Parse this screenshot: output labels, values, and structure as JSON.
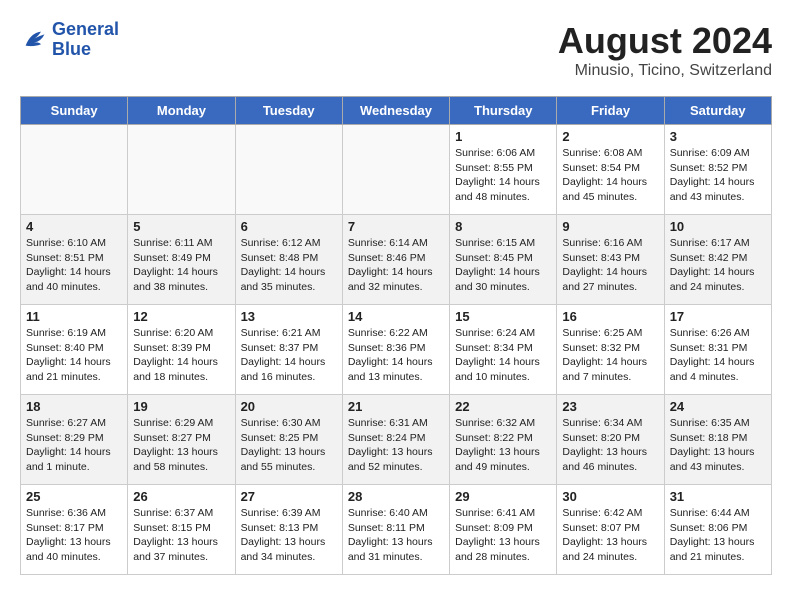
{
  "header": {
    "logo_line1": "General",
    "logo_line2": "Blue",
    "month_year": "August 2024",
    "location": "Minusio, Ticino, Switzerland"
  },
  "days_of_week": [
    "Sunday",
    "Monday",
    "Tuesday",
    "Wednesday",
    "Thursday",
    "Friday",
    "Saturday"
  ],
  "weeks": [
    [
      {
        "day": "",
        "info": "",
        "empty": true
      },
      {
        "day": "",
        "info": "",
        "empty": true
      },
      {
        "day": "",
        "info": "",
        "empty": true
      },
      {
        "day": "",
        "info": "",
        "empty": true
      },
      {
        "day": "1",
        "info": "Sunrise: 6:06 AM\nSunset: 8:55 PM\nDaylight: 14 hours\nand 48 minutes."
      },
      {
        "day": "2",
        "info": "Sunrise: 6:08 AM\nSunset: 8:54 PM\nDaylight: 14 hours\nand 45 minutes."
      },
      {
        "day": "3",
        "info": "Sunrise: 6:09 AM\nSunset: 8:52 PM\nDaylight: 14 hours\nand 43 minutes."
      }
    ],
    [
      {
        "day": "4",
        "info": "Sunrise: 6:10 AM\nSunset: 8:51 PM\nDaylight: 14 hours\nand 40 minutes.",
        "shaded": true
      },
      {
        "day": "5",
        "info": "Sunrise: 6:11 AM\nSunset: 8:49 PM\nDaylight: 14 hours\nand 38 minutes.",
        "shaded": true
      },
      {
        "day": "6",
        "info": "Sunrise: 6:12 AM\nSunset: 8:48 PM\nDaylight: 14 hours\nand 35 minutes.",
        "shaded": true
      },
      {
        "day": "7",
        "info": "Sunrise: 6:14 AM\nSunset: 8:46 PM\nDaylight: 14 hours\nand 32 minutes.",
        "shaded": true
      },
      {
        "day": "8",
        "info": "Sunrise: 6:15 AM\nSunset: 8:45 PM\nDaylight: 14 hours\nand 30 minutes.",
        "shaded": true
      },
      {
        "day": "9",
        "info": "Sunrise: 6:16 AM\nSunset: 8:43 PM\nDaylight: 14 hours\nand 27 minutes.",
        "shaded": true
      },
      {
        "day": "10",
        "info": "Sunrise: 6:17 AM\nSunset: 8:42 PM\nDaylight: 14 hours\nand 24 minutes.",
        "shaded": true
      }
    ],
    [
      {
        "day": "11",
        "info": "Sunrise: 6:19 AM\nSunset: 8:40 PM\nDaylight: 14 hours\nand 21 minutes."
      },
      {
        "day": "12",
        "info": "Sunrise: 6:20 AM\nSunset: 8:39 PM\nDaylight: 14 hours\nand 18 minutes."
      },
      {
        "day": "13",
        "info": "Sunrise: 6:21 AM\nSunset: 8:37 PM\nDaylight: 14 hours\nand 16 minutes."
      },
      {
        "day": "14",
        "info": "Sunrise: 6:22 AM\nSunset: 8:36 PM\nDaylight: 14 hours\nand 13 minutes."
      },
      {
        "day": "15",
        "info": "Sunrise: 6:24 AM\nSunset: 8:34 PM\nDaylight: 14 hours\nand 10 minutes."
      },
      {
        "day": "16",
        "info": "Sunrise: 6:25 AM\nSunset: 8:32 PM\nDaylight: 14 hours\nand 7 minutes."
      },
      {
        "day": "17",
        "info": "Sunrise: 6:26 AM\nSunset: 8:31 PM\nDaylight: 14 hours\nand 4 minutes."
      }
    ],
    [
      {
        "day": "18",
        "info": "Sunrise: 6:27 AM\nSunset: 8:29 PM\nDaylight: 14 hours\nand 1 minute.",
        "shaded": true
      },
      {
        "day": "19",
        "info": "Sunrise: 6:29 AM\nSunset: 8:27 PM\nDaylight: 13 hours\nand 58 minutes.",
        "shaded": true
      },
      {
        "day": "20",
        "info": "Sunrise: 6:30 AM\nSunset: 8:25 PM\nDaylight: 13 hours\nand 55 minutes.",
        "shaded": true
      },
      {
        "day": "21",
        "info": "Sunrise: 6:31 AM\nSunset: 8:24 PM\nDaylight: 13 hours\nand 52 minutes.",
        "shaded": true
      },
      {
        "day": "22",
        "info": "Sunrise: 6:32 AM\nSunset: 8:22 PM\nDaylight: 13 hours\nand 49 minutes.",
        "shaded": true
      },
      {
        "day": "23",
        "info": "Sunrise: 6:34 AM\nSunset: 8:20 PM\nDaylight: 13 hours\nand 46 minutes.",
        "shaded": true
      },
      {
        "day": "24",
        "info": "Sunrise: 6:35 AM\nSunset: 8:18 PM\nDaylight: 13 hours\nand 43 minutes.",
        "shaded": true
      }
    ],
    [
      {
        "day": "25",
        "info": "Sunrise: 6:36 AM\nSunset: 8:17 PM\nDaylight: 13 hours\nand 40 minutes."
      },
      {
        "day": "26",
        "info": "Sunrise: 6:37 AM\nSunset: 8:15 PM\nDaylight: 13 hours\nand 37 minutes."
      },
      {
        "day": "27",
        "info": "Sunrise: 6:39 AM\nSunset: 8:13 PM\nDaylight: 13 hours\nand 34 minutes."
      },
      {
        "day": "28",
        "info": "Sunrise: 6:40 AM\nSunset: 8:11 PM\nDaylight: 13 hours\nand 31 minutes."
      },
      {
        "day": "29",
        "info": "Sunrise: 6:41 AM\nSunset: 8:09 PM\nDaylight: 13 hours\nand 28 minutes."
      },
      {
        "day": "30",
        "info": "Sunrise: 6:42 AM\nSunset: 8:07 PM\nDaylight: 13 hours\nand 24 minutes."
      },
      {
        "day": "31",
        "info": "Sunrise: 6:44 AM\nSunset: 8:06 PM\nDaylight: 13 hours\nand 21 minutes."
      }
    ]
  ]
}
